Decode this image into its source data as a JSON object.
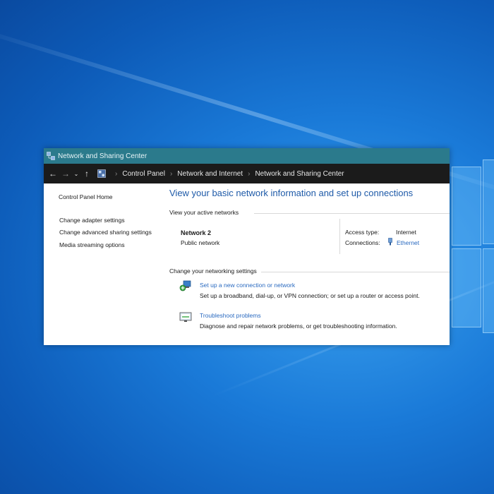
{
  "window": {
    "title": "Network and Sharing Center"
  },
  "address_bar": {
    "breadcrumbs": [
      "Control Panel",
      "Network and Internet",
      "Network and Sharing Center"
    ]
  },
  "sidebar": {
    "home": "Control Panel Home",
    "links": [
      "Change adapter settings",
      "Change advanced sharing settings",
      "Media streaming options"
    ]
  },
  "main": {
    "title": "View your basic network information and set up connections",
    "active_networks_label": "View your active networks",
    "network": {
      "name": "Network 2",
      "type": "Public network",
      "access_type_label": "Access type:",
      "access_type_value": "Internet",
      "connections_label": "Connections:",
      "connections_value": "Ethernet"
    },
    "change_settings_label": "Change your networking settings",
    "tasks": [
      {
        "icon": "new-connection-icon",
        "link": "Set up a new connection or network",
        "description": "Set up a broadband, dial-up, or VPN connection; or set up a router or access point."
      },
      {
        "icon": "troubleshoot-icon",
        "link": "Troubleshoot problems",
        "description": "Diagnose and repair network problems, or get troubleshooting information."
      }
    ]
  },
  "colors": {
    "titlebar": "#2b7a8c",
    "addressbar": "#1b1b1b",
    "link": "#2a6ac0",
    "page_title": "#1e5aa8"
  }
}
